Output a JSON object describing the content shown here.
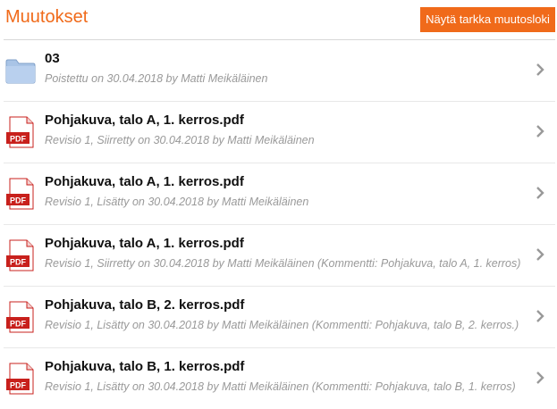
{
  "header": {
    "title": "Muutokset",
    "log_button": "Näytä tarkka muutosloki"
  },
  "changes": [
    {
      "icon": "folder-icon",
      "name": "03",
      "meta": "Poistettu on 30.04.2018 by Matti Meikäläinen"
    },
    {
      "icon": "pdf-icon",
      "name": "Pohjakuva, talo A, 1. kerros.pdf",
      "meta": "Revisio 1, Siirretty on 30.04.2018 by Matti Meikäläinen"
    },
    {
      "icon": "pdf-icon",
      "name": "Pohjakuva, talo A, 1. kerros.pdf",
      "meta": "Revisio 1, Lisätty on 30.04.2018 by Matti Meikäläinen"
    },
    {
      "icon": "pdf-icon",
      "name": "Pohjakuva, talo A, 1. kerros.pdf",
      "meta": "Revisio 1, Siirretty on 30.04.2018 by Matti Meikäläinen (Kommentti: Pohjakuva, talo A, 1. kerros)"
    },
    {
      "icon": "pdf-icon",
      "name": "Pohjakuva, talo B, 2. kerros.pdf",
      "meta": "Revisio 1, Lisätty on 30.04.2018 by Matti Meikäläinen (Kommentti: Pohjakuva, talo B, 2. kerros.)"
    },
    {
      "icon": "pdf-icon",
      "name": "Pohjakuva, talo B, 1. kerros.pdf",
      "meta": "Revisio 1, Lisätty on 30.04.2018 by Matti Meikäläinen (Kommentti: Pohjakuva, talo B, 1. kerros)"
    }
  ],
  "pdf_icon_label": "PDF",
  "colors": {
    "accent": "#f06a1a",
    "pdf_red": "#c8201c",
    "folder_blue": "#9bbbe0"
  }
}
